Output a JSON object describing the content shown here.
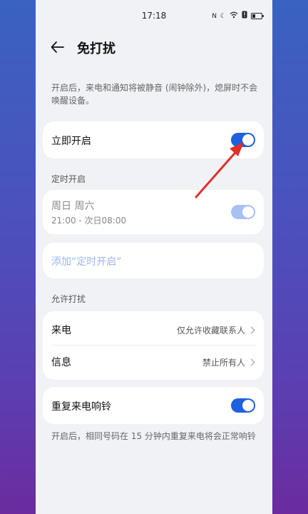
{
  "status_bar": {
    "time": "17:18",
    "icons": [
      "nfc-icon",
      "moon-icon",
      "wifi-icon",
      "alert-icon",
      "battery-icon"
    ]
  },
  "header": {
    "title": "免打扰"
  },
  "description": "开启后，来电和通知将被静音 (闹钟除外)，熄屏时不会唤醒设备。",
  "immediate": {
    "label": "立即开启",
    "enabled": true
  },
  "scheduled": {
    "section_title": "定时开启",
    "item": {
      "days": "周日 周六",
      "time": "21:00 - 次日08:00",
      "enabled": true
    },
    "add_label": "添加“定时开启”"
  },
  "allow": {
    "section_title": "允许打扰",
    "calls": {
      "label": "来电",
      "value": "仅允许收藏联系人"
    },
    "messages": {
      "label": "信息",
      "value": "禁止所有人"
    }
  },
  "repeat_calls": {
    "label": "重复来电响铃",
    "enabled": true,
    "description": "开启后，相同号码在 15 分钟内重复来电将会正常响铃"
  },
  "colors": {
    "accent": "#1f5fe0",
    "annotation_arrow": "#e0302a"
  }
}
